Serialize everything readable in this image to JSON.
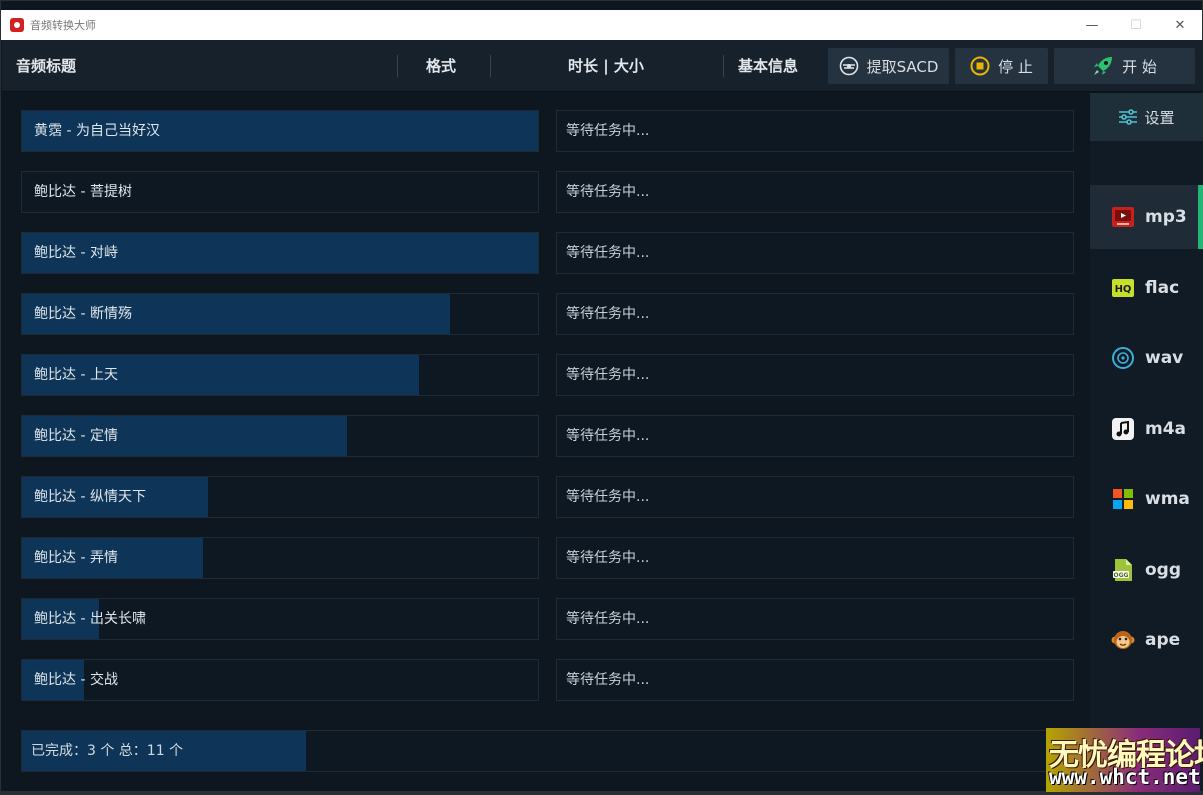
{
  "window": {
    "title": "音频转换大师",
    "controls": {
      "minimize": "—",
      "maximize": "☐",
      "close": "✕"
    }
  },
  "header": {
    "col_title": "音频标题",
    "col_format": "格式",
    "col_duration_size": "时长 | 大小",
    "col_info": "基本信息",
    "btn_sacd": "提取SACD",
    "btn_stop": "停 止",
    "btn_start": "开 始"
  },
  "tracks": [
    {
      "title": "黄霑 - 为自己当好汉",
      "status": "等待任务中...",
      "progress": 1.0
    },
    {
      "title": "鲍比达 - 菩提树",
      "status": "等待任务中...",
      "progress": 0.0
    },
    {
      "title": "鲍比达 - 对峙",
      "status": "等待任务中...",
      "progress": 1.0
    },
    {
      "title": "鲍比达 - 断情殇",
      "status": "等待任务中...",
      "progress": 0.83
    },
    {
      "title": "鲍比达 - 上天",
      "status": "等待任务中...",
      "progress": 0.77
    },
    {
      "title": "鲍比达 - 定情",
      "status": "等待任务中...",
      "progress": 0.63
    },
    {
      "title": "鲍比达 - 纵情天下",
      "status": "等待任务中...",
      "progress": 0.36
    },
    {
      "title": "鲍比达 - 弄情",
      "status": "等待任务中...",
      "progress": 0.35
    },
    {
      "title": "鲍比达 - 出关长啸",
      "status": "等待任务中...",
      "progress": 0.15
    },
    {
      "title": "鲍比达 - 交战",
      "status": "等待任务中...",
      "progress": 0.12
    }
  ],
  "footer": {
    "summary": "已完成：3 个 总：11 个",
    "progress": 0.27
  },
  "sidebar": {
    "settings_label": "设置",
    "formats": [
      {
        "label": "mp3",
        "icon": "mp3-icon",
        "active": true
      },
      {
        "label": "flac",
        "icon": "flac-hq-icon",
        "active": false
      },
      {
        "label": "wav",
        "icon": "wav-disc-icon",
        "active": false
      },
      {
        "label": "m4a",
        "icon": "m4a-music-note-icon",
        "active": false
      },
      {
        "label": "wma",
        "icon": "wma-windows-icon",
        "active": false
      },
      {
        "label": "ogg",
        "icon": "ogg-file-icon",
        "active": false
      },
      {
        "label": "ape",
        "icon": "ape-monkey-icon",
        "active": false
      }
    ]
  },
  "watermark": {
    "line1": "无忧编程论坛",
    "line2": "www.whct.net"
  },
  "colors": {
    "progress_fill": "#0e3558",
    "active_accent": "#22b573",
    "background": "#0e1720"
  }
}
